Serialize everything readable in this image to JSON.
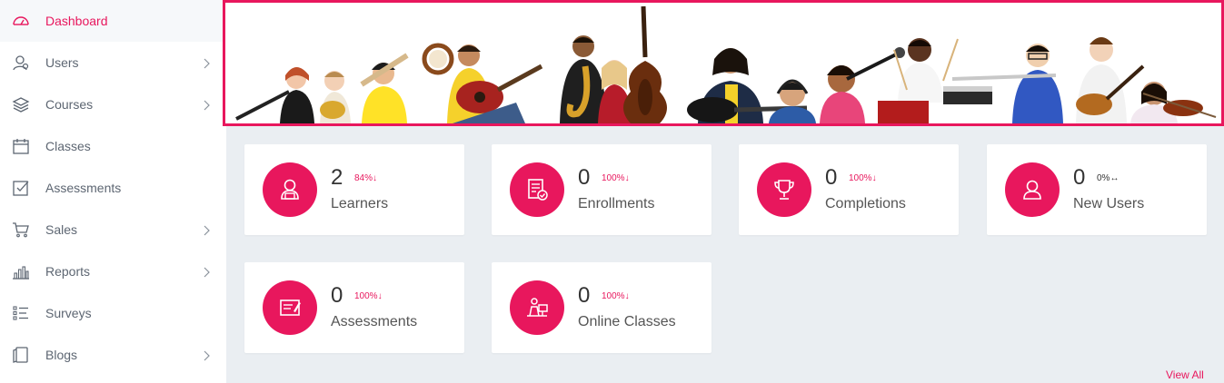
{
  "sidebar": {
    "items": [
      {
        "label": "Dashboard",
        "icon": "gauge-icon",
        "active": true,
        "has_submenu": false
      },
      {
        "label": "Users",
        "icon": "users-icon",
        "active": false,
        "has_submenu": true
      },
      {
        "label": "Courses",
        "icon": "layers-icon",
        "active": false,
        "has_submenu": true
      },
      {
        "label": "Classes",
        "icon": "calendar-icon",
        "active": false,
        "has_submenu": false
      },
      {
        "label": "Assessments",
        "icon": "checkbox-icon",
        "active": false,
        "has_submenu": false
      },
      {
        "label": "Sales",
        "icon": "cart-icon",
        "active": false,
        "has_submenu": true
      },
      {
        "label": "Reports",
        "icon": "bar-chart-icon",
        "active": false,
        "has_submenu": true
      },
      {
        "label": "Surveys",
        "icon": "list-icon",
        "active": false,
        "has_submenu": false
      },
      {
        "label": "Blogs",
        "icon": "blog-icon",
        "active": false,
        "has_submenu": true
      }
    ]
  },
  "stats": [
    {
      "value": "2",
      "trend": "84%↓",
      "label": "Learners",
      "icon": "learner-icon"
    },
    {
      "value": "0",
      "trend": "100%↓",
      "label": "Enrollments",
      "icon": "enrollment-icon"
    },
    {
      "value": "0",
      "trend": "100%↓",
      "label": "Completions",
      "icon": "trophy-icon"
    },
    {
      "value": "0",
      "trend": "0%↔",
      "label": "New Users",
      "icon": "new-user-icon"
    },
    {
      "value": "0",
      "trend": "100%↓",
      "label": "Assessments",
      "icon": "assessment-icon"
    },
    {
      "value": "0",
      "trend": "100%↓",
      "label": "Online Classes",
      "icon": "online-class-icon"
    }
  ],
  "view_all": "View All",
  "colors": {
    "accent": "#e8175d",
    "background": "#eaeef2",
    "sidebar": "#ffffff",
    "text": "#5d6672"
  }
}
